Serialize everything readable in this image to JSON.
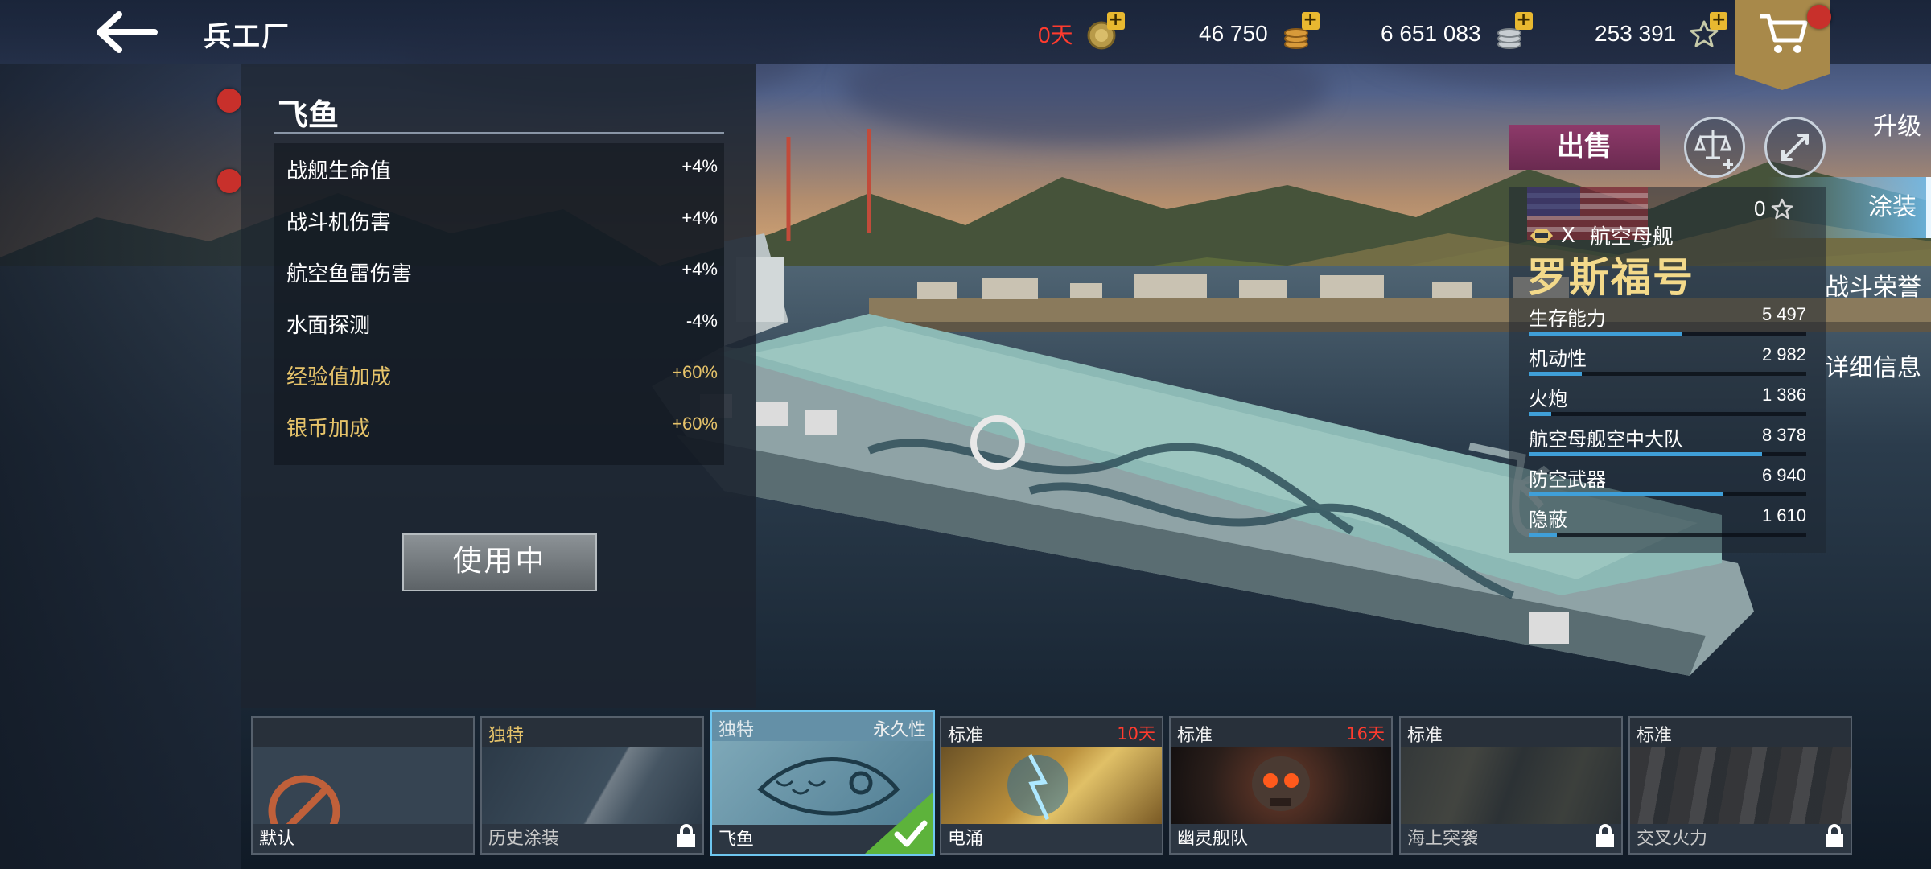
{
  "header": {
    "title": "兵工厂",
    "resources": [
      {
        "name": "premium-days",
        "value": "0天",
        "icon": "medal-icon",
        "color": "#ff3b2e"
      },
      {
        "name": "gold",
        "value": "46 750",
        "icon": "gold-coins-icon",
        "color": "#ffffff"
      },
      {
        "name": "silver",
        "value": "6 651 083",
        "icon": "silver-coins-icon",
        "color": "#ffffff"
      },
      {
        "name": "experience",
        "value": "253 391",
        "icon": "star-icon",
        "color": "#ffffff"
      }
    ],
    "plus_symbol": "+"
  },
  "sidebar": {
    "items": [
      {
        "label": "升级",
        "badge": true,
        "active": false
      },
      {
        "label": "涂装",
        "badge": true,
        "active": true
      },
      {
        "label": "战斗荣誉",
        "badge": false,
        "active": false
      },
      {
        "label": "详细信息",
        "badge": false,
        "active": false
      }
    ]
  },
  "skin_detail": {
    "name": "飞鱼",
    "bonuses": [
      {
        "label": "战舰生命值",
        "value": "+4%",
        "highlight": false
      },
      {
        "label": "战斗机伤害",
        "value": "+4%",
        "highlight": false
      },
      {
        "label": "航空鱼雷伤害",
        "value": "+4%",
        "highlight": false
      },
      {
        "label": "水面探测",
        "value": "-4%",
        "highlight": false
      },
      {
        "label": "经验值加成",
        "value": "+60%",
        "highlight": true
      },
      {
        "label": "银币加成",
        "value": "+60%",
        "highlight": true
      }
    ],
    "status_button": "使用中"
  },
  "ship": {
    "sell_label": "出售",
    "stars": "0",
    "tier": "X",
    "type": "航空母舰",
    "name": "罗斯福号",
    "stats": [
      {
        "label": "生存能力",
        "value": "5 497",
        "fill": 0.55
      },
      {
        "label": "机动性",
        "value": "2 982",
        "fill": 0.19
      },
      {
        "label": "火炮",
        "value": "1 386",
        "fill": 0.08
      },
      {
        "label": "航空母舰空中大队",
        "value": "8 378",
        "fill": 0.84
      },
      {
        "label": "防空武器",
        "value": "6 940",
        "fill": 0.7
      },
      {
        "label": "隐蔽",
        "value": "1 610",
        "fill": 0.1
      }
    ]
  },
  "skins": [
    {
      "name": "默认",
      "tier": "",
      "tier_style": "normal",
      "tag": "",
      "tag_type": "",
      "locked": false,
      "selected": false
    },
    {
      "name": "历史涂装",
      "tier": "独特",
      "tier_style": "gold",
      "tag": "",
      "tag_type": "",
      "locked": true,
      "selected": false
    },
    {
      "name": "飞鱼",
      "tier": "独特",
      "tier_style": "gold",
      "tag": "永久性",
      "tag_type": "perm",
      "locked": false,
      "selected": true
    },
    {
      "name": "电涌",
      "tier": "标准",
      "tier_style": "normal",
      "tag": "10天",
      "tag_type": "days",
      "locked": false,
      "selected": false
    },
    {
      "name": "幽灵舰队",
      "tier": "标准",
      "tier_style": "normal",
      "tag": "16天",
      "tag_type": "days",
      "locked": false,
      "selected": false
    },
    {
      "name": "海上突袭",
      "tier": "标准",
      "tier_style": "normal",
      "tag": "",
      "tag_type": "",
      "locked": true,
      "selected": false
    },
    {
      "name": "交叉火力",
      "tier": "标准",
      "tier_style": "normal",
      "tag": "",
      "tag_type": "",
      "locked": true,
      "selected": false
    }
  ]
}
